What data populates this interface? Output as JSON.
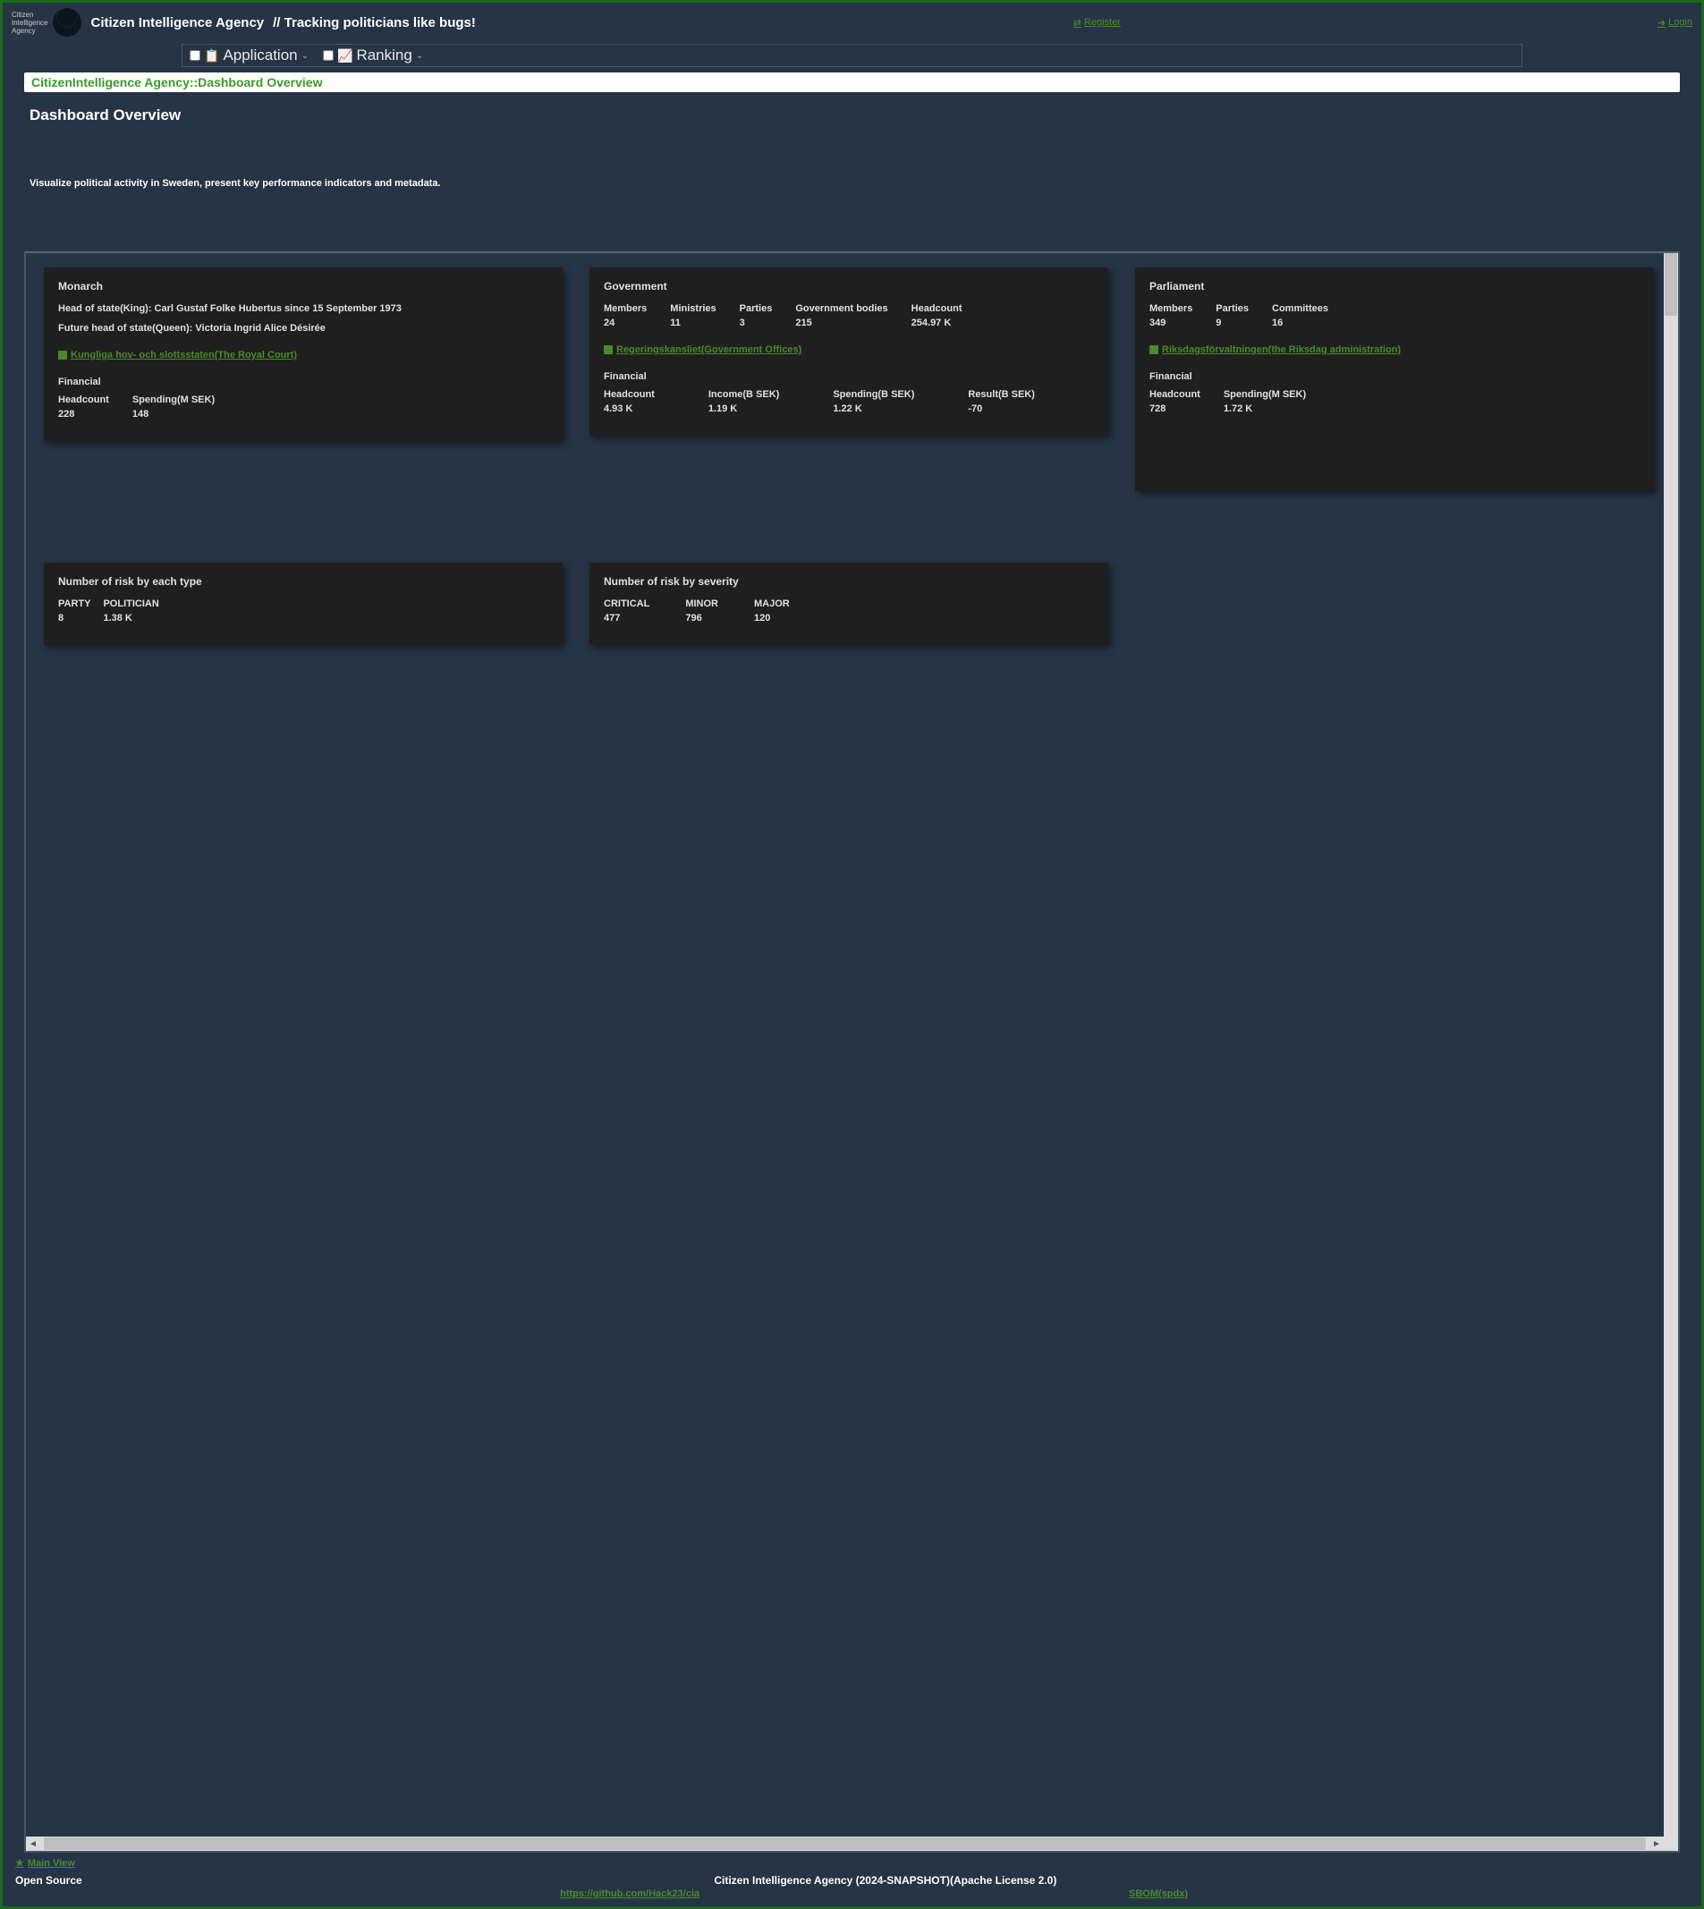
{
  "header": {
    "logo_text": "Citizen\nIntelligence\nAgency",
    "title": "Citizen Intelligence Agency",
    "tagline": "// Tracking politicians like bugs!",
    "register": "Register",
    "login": "Login"
  },
  "menu": {
    "application": "Application",
    "ranking": "Ranking"
  },
  "breadcrumb": "CitizenIntelligence Agency::Dashboard Overview",
  "page": {
    "title": "Dashboard Overview",
    "description": "Visualize political activity in Sweden, present key performance indicators and metadata."
  },
  "monarch": {
    "title": "Monarch",
    "head_of_state": "Head of state(King): Carl Gustaf Folke Hubertus since 15 September 1973",
    "future_head": "Future head of state(Queen): Victoria Ingrid Alice Désirée",
    "link": "Kungliga hov- och slottsstaten(The Royal Court)",
    "financial_title": "Financial",
    "stats": [
      {
        "lbl": "Headcount",
        "val": "228"
      },
      {
        "lbl": "Spending(M SEK)",
        "val": "148"
      }
    ]
  },
  "government": {
    "title": "Government",
    "stats_top": [
      {
        "lbl": "Members",
        "val": "24"
      },
      {
        "lbl": "Ministries",
        "val": "11"
      },
      {
        "lbl": "Parties",
        "val": "3"
      },
      {
        "lbl": "Government bodies",
        "val": "215"
      },
      {
        "lbl": "Headcount",
        "val": "254.97 K"
      }
    ],
    "link": "Regeringskansliet(Government Offices)",
    "financial_title": "Financial",
    "stats_fin": [
      {
        "lbl": "Headcount",
        "val": "4.93 K"
      },
      {
        "lbl": "Income(B SEK)",
        "val": "1.19 K"
      },
      {
        "lbl": "Spending(B SEK)",
        "val": "1.22 K"
      },
      {
        "lbl": "Result(B SEK)",
        "val": "-70"
      }
    ]
  },
  "parliament": {
    "title": "Parliament",
    "stats_top": [
      {
        "lbl": "Members",
        "val": "349"
      },
      {
        "lbl": "Parties",
        "val": "9"
      },
      {
        "lbl": "Committees",
        "val": "16"
      }
    ],
    "link": "Riksdagsförvaltningen(the Riksdag administration)",
    "financial_title": "Financial",
    "stats_fin": [
      {
        "lbl": "Headcount",
        "val": "728"
      },
      {
        "lbl": "Spending(M SEK)",
        "val": "1.72 K"
      }
    ]
  },
  "risk_type": {
    "title": "Number of risk by each type",
    "stats": [
      {
        "lbl": "PARTY",
        "val": "8"
      },
      {
        "lbl": "POLITICIAN",
        "val": "1.38 K"
      }
    ]
  },
  "risk_severity": {
    "title": "Number of risk by severity",
    "stats": [
      {
        "lbl": "CRITICAL",
        "val": "477"
      },
      {
        "lbl": "MINOR",
        "val": "796"
      },
      {
        "lbl": "MAJOR",
        "val": "120"
      }
    ]
  },
  "footer": {
    "main_view": "Main View",
    "open_source": "Open Source",
    "center": "Citizen Intelligence Agency (2024-SNAPSHOT)(Apache License 2.0)",
    "github": "https://github.com/Hack23/cia",
    "sbom": "SBOM(spdx)"
  }
}
